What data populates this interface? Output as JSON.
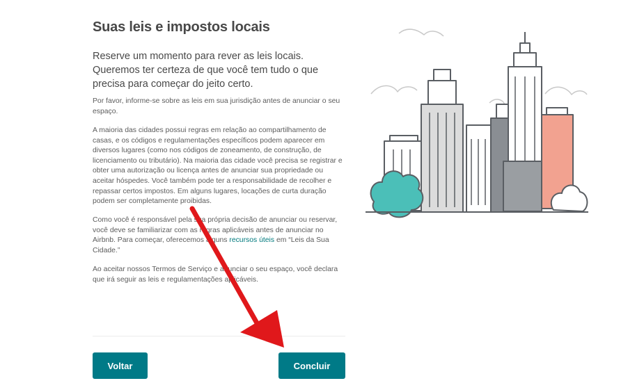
{
  "page": {
    "title": "Suas leis e impostos locais",
    "lead": "Reserve um momento para rever as leis locais. Queremos ter certeza de que você tem tudo o que precisa para começar do jeito certo.",
    "paragraph1": "Por favor, informe-se sobre as leis em sua jurisdição antes de anunciar o seu espaço.",
    "paragraph2": "A maioria das cidades possui regras em relação ao compartilhamento de casas, e os códigos e regulamentações específicos podem aparecer em diversos lugares (como nos códigos de zoneamento, de construção, de licenciamento ou tributário). Na maioria das cidade você precisa se registrar e obter uma autorização ou licença antes de anunciar sua propriedade ou aceitar hóspedes. Você também pode ter a responsabilidade de recolher e repassar certos impostos. Em alguns lugares, locações de curta duração podem ser completamente proibidas.",
    "paragraph3_before": "Como você é responsável pela sua própria decisão de anunciar ou reservar, você deve se familiarizar com as regras aplicáveis antes de anunciar no Airbnb. Para começar, oferecemos alguns ",
    "paragraph3_link": "recursos úteis",
    "paragraph3_after": " em “Leis da Sua Cidade.”",
    "paragraph4": "Ao aceitar nossos Termos de Serviço e anunciar o seu espaço, você declara que irá seguir as leis e regulamentações aplicáveis."
  },
  "buttons": {
    "back": "Voltar",
    "done": "Concluir"
  },
  "colors": {
    "button": "#007a87",
    "link": "#00797d",
    "tree": "#4bbfb8",
    "accent_building": "#f2a290",
    "arrow": "#e0181b"
  },
  "icons": {
    "illustration": "city-skyline-illustration",
    "annotation": "red-arrow-annotation"
  }
}
